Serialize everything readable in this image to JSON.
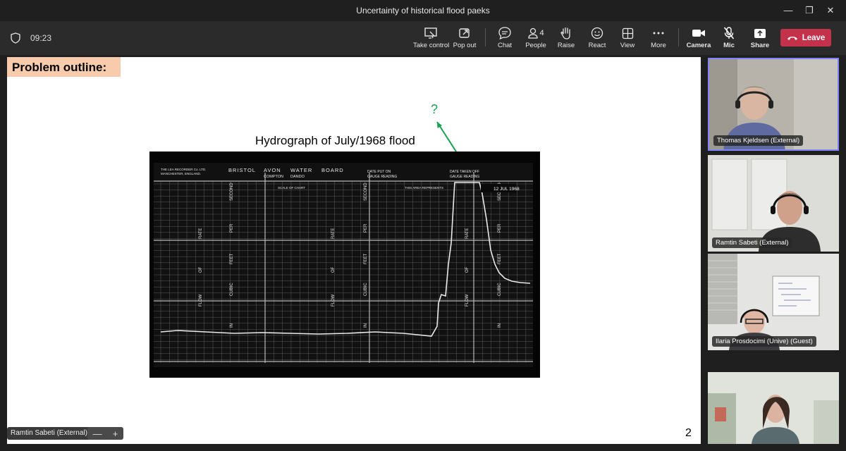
{
  "window": {
    "title": "Uncertainty of historical flood paeks",
    "minimize": "—",
    "maximize": "❐",
    "close": "✕"
  },
  "meeting": {
    "timer": "09:23",
    "buttons": {
      "take_control": "Take control",
      "pop_out": "Pop out",
      "chat": "Chat",
      "people": "People",
      "people_count": "4",
      "raise": "Raise",
      "react": "React",
      "view": "View",
      "more": "More",
      "camera": "Camera",
      "mic": "Mic",
      "share": "Share",
      "leave": "Leave"
    },
    "colors": {
      "leave": "#c4314b",
      "active_speaker": "#6264a7"
    }
  },
  "slide": {
    "label": "Problem outline:",
    "title": "Hydrograph of July/1968 flood",
    "annotation": "?",
    "page_number": "2",
    "chart_text": {
      "header_left_1": "THE LEA RECORDER Co. LTD.",
      "header_left_2": "MANCHESTER, ENGLAND.",
      "board_1": "BRISTOL",
      "board_2": "AVON",
      "board_3": "WATER",
      "board_4": "BOARD",
      "location_1": "COMPTON",
      "location_2": "DANDO",
      "date_put_on": "DATE PUT ON",
      "date_taken_off": "DATE TAKEN OFF",
      "gauge_reading_1": "GAUGE READING",
      "gauge_reading_2": "GAUGE READING",
      "scale_of_chart": "SCALE OF CHART",
      "area_represents": "THIS AREA REPRESENTS",
      "rate_of_flow": [
        "RATE",
        "OF",
        "FLOW"
      ],
      "cubic_feet_per_second": [
        "IN",
        "CUBIC",
        "FEET",
        "PER",
        "SECOND"
      ]
    }
  },
  "presenter": {
    "name": "Ramtin Sabeti (External)"
  },
  "zoom": {
    "minus": "—",
    "plus": "+"
  },
  "participants": [
    {
      "name": "Thomas Kjeldsen (External)",
      "active": true
    },
    {
      "name": "Ramtin Sabeti (External)",
      "active": false
    },
    {
      "name": "Ilaria Prosdocimi (Unive) (Guest)",
      "active": false
    },
    {
      "name": "",
      "active": false
    }
  ]
}
